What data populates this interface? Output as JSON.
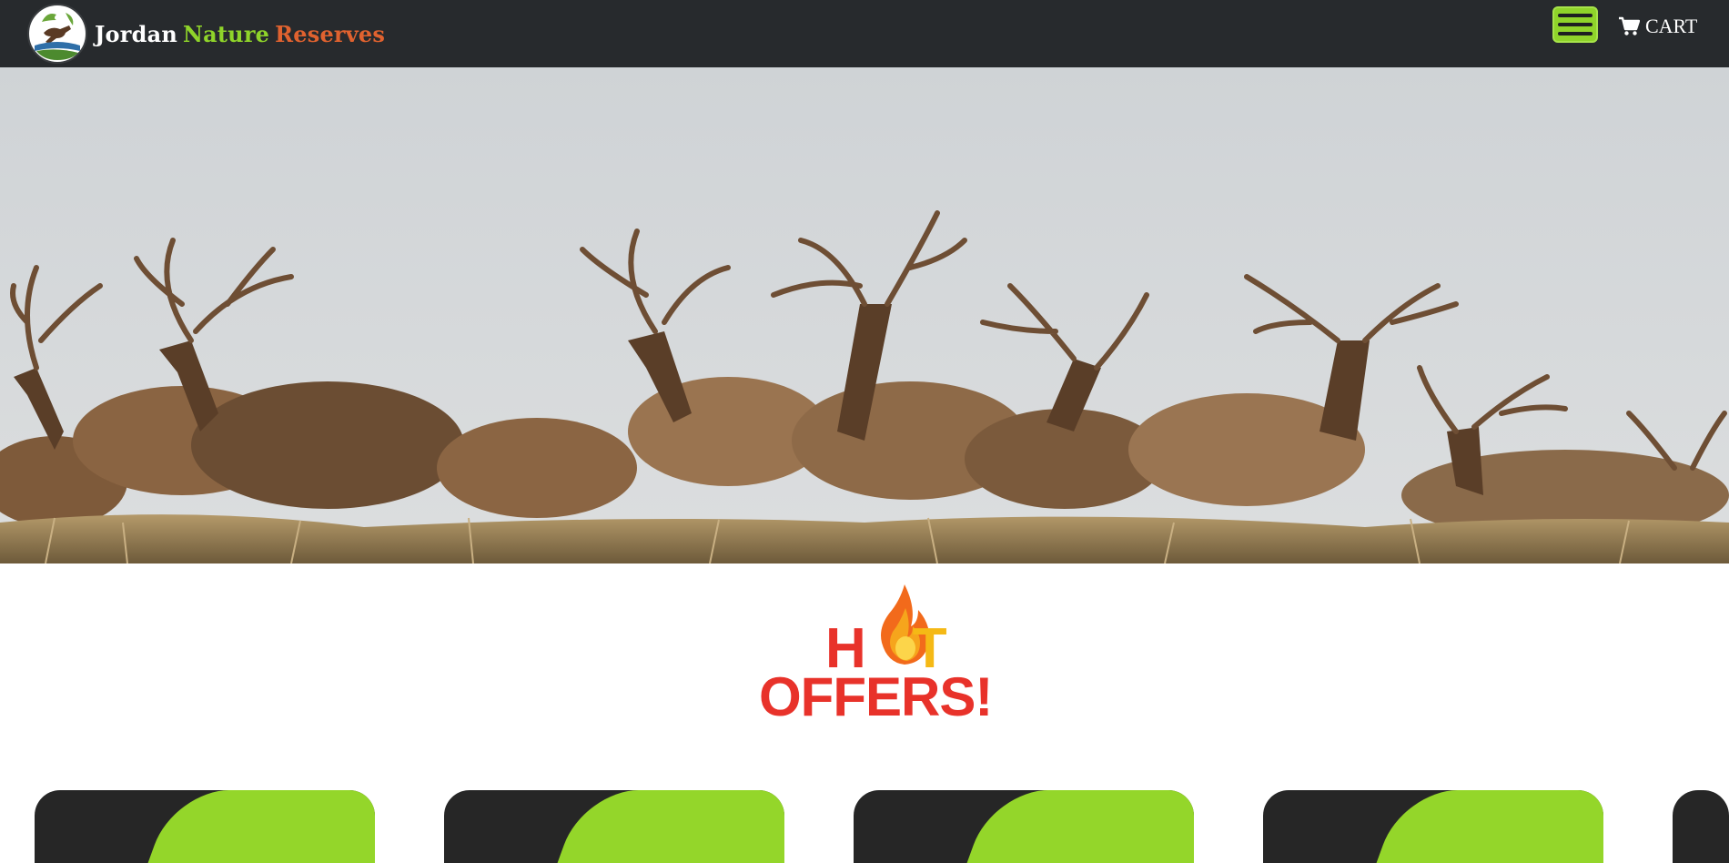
{
  "header": {
    "brand": {
      "part1": "Jordan",
      "part2": "Nature",
      "part3": "Reserves"
    },
    "menu_icon": "hamburger-menu-icon",
    "cart": {
      "icon": "shopping-cart-icon",
      "label": "CART"
    }
  },
  "hero": {
    "alt": "Herd of elk with large antlers in a grassy field"
  },
  "hot_offers": {
    "line1_a": "H",
    "line1_b": "T",
    "line2": "OFFERS!",
    "icon": "flame-icon"
  },
  "colors": {
    "header_bg": "#272a2d",
    "brand_green": "#8fd42a",
    "brand_orange": "#e0622f",
    "offer_red": "#e8322a",
    "card_dark": "#262626",
    "card_green": "#94d62a"
  },
  "offer_cards": [
    {},
    {},
    {},
    {},
    {}
  ]
}
